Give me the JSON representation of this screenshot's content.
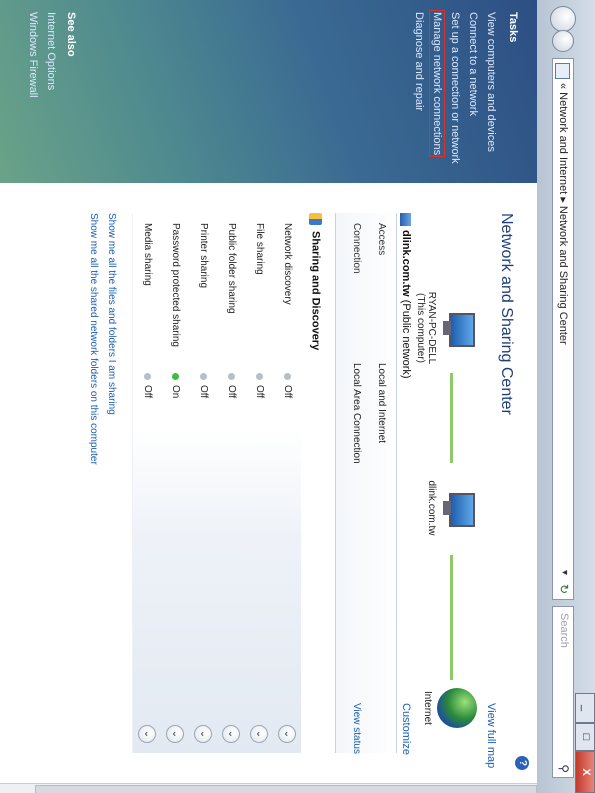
{
  "window": {
    "minimize_label": "_",
    "maximize_label": "□",
    "close_label": "X"
  },
  "address": {
    "crumbs": "« Network and Internet ▸ Network and Sharing Center",
    "dropdown": "▾",
    "refresh": "↻",
    "search_placeholder": "Search"
  },
  "left": {
    "tasks_heading": "Tasks",
    "tasks": [
      "View computers and devices",
      "Connect to a network",
      "Set up a connection or network",
      "Manage network connections",
      "Diagnose and repair"
    ],
    "see_also_heading": "See also",
    "see_also": [
      "Internet Options",
      "Windows Firewall"
    ]
  },
  "main": {
    "title": "Network and Sharing Center",
    "view_full_map": "View full map",
    "help": "?",
    "nodes": [
      {
        "name": "RYAN-PC-DELL",
        "sub": "(This computer)"
      },
      {
        "name": "dlink.com.tw",
        "sub": ""
      },
      {
        "name": "Internet",
        "sub": ""
      }
    ],
    "network": {
      "name": "dlink.com.tw",
      "type": "(Public network)",
      "customize": "Customize",
      "rows": [
        {
          "label": "Access",
          "value": "Local and Internet",
          "link": ""
        },
        {
          "label": "Connection",
          "value": "Local Area Connection",
          "link": "View status"
        }
      ]
    },
    "sharing_title": "Sharing and Discovery",
    "sharing": [
      {
        "label": "Network discovery",
        "status": "Off",
        "on": false
      },
      {
        "label": "File sharing",
        "status": "Off",
        "on": false
      },
      {
        "label": "Public folder sharing",
        "status": "Off",
        "on": false
      },
      {
        "label": "Printer sharing",
        "status": "Off",
        "on": false
      },
      {
        "label": "Password protected sharing",
        "status": "On",
        "on": true
      },
      {
        "label": "Media sharing",
        "status": "Off",
        "on": false
      }
    ],
    "expand_glyph": "⌄",
    "footer_links": [
      "Show me all the files and folders I am sharing",
      "Show me all the shared network folders on this computer"
    ]
  }
}
